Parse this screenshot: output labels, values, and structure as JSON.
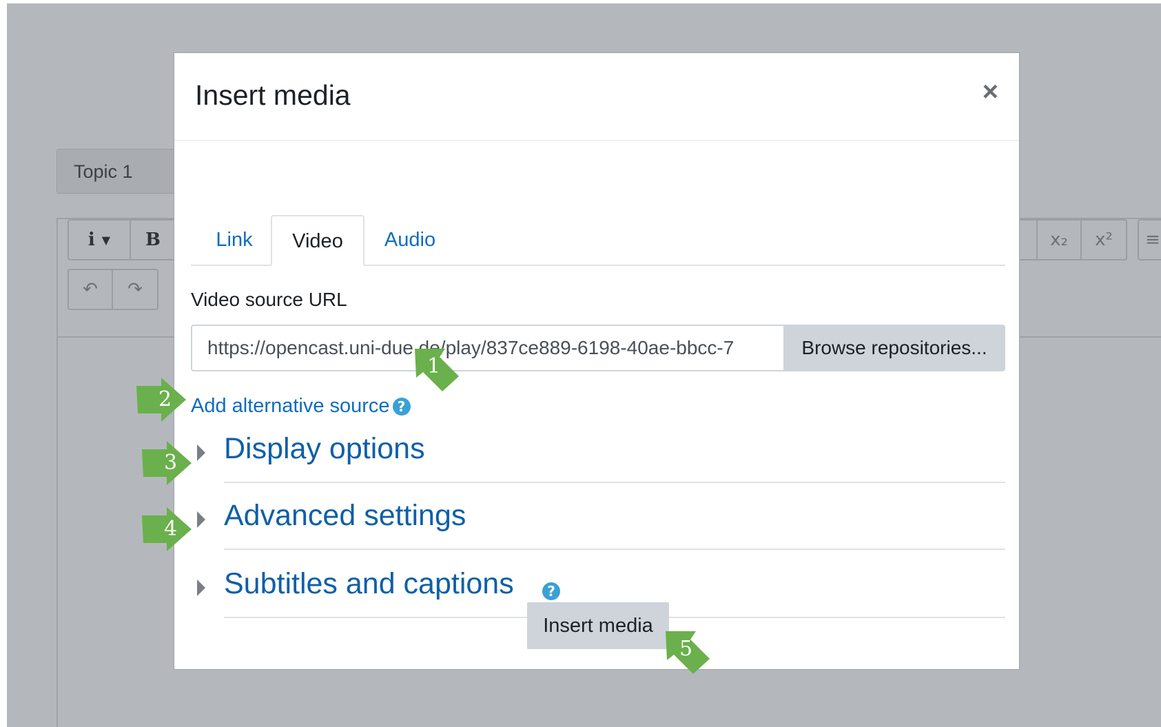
{
  "background": {
    "topic_label": "Topic 1",
    "toolbar": {
      "info_label": "i",
      "bold_label": "B",
      "subscript_label": "x₂",
      "superscript_label": "x²"
    }
  },
  "modal": {
    "title": "Insert media",
    "close_label": "×",
    "tabs": [
      {
        "label": "Link",
        "active": false
      },
      {
        "label": "Video",
        "active": true
      },
      {
        "label": "Audio",
        "active": false
      }
    ],
    "video_source": {
      "label": "Video source URL",
      "value": "https://opencast.uni-due.de/play/837ce889-6198-40ae-bbcc-7",
      "browse_label": "Browse repositories..."
    },
    "alt_source_label": "Add alternative source",
    "sections": [
      {
        "label": "Display options"
      },
      {
        "label": "Advanced settings"
      },
      {
        "label": "Subtitles and captions"
      }
    ],
    "insert_label": "Insert media",
    "help_icon": "?"
  },
  "callouts": [
    "1",
    "2",
    "3",
    "4",
    "5"
  ],
  "colors": {
    "link": "#0f6cbf",
    "callout_green": "#6ab04c",
    "overlay": "#b4b8bc"
  }
}
